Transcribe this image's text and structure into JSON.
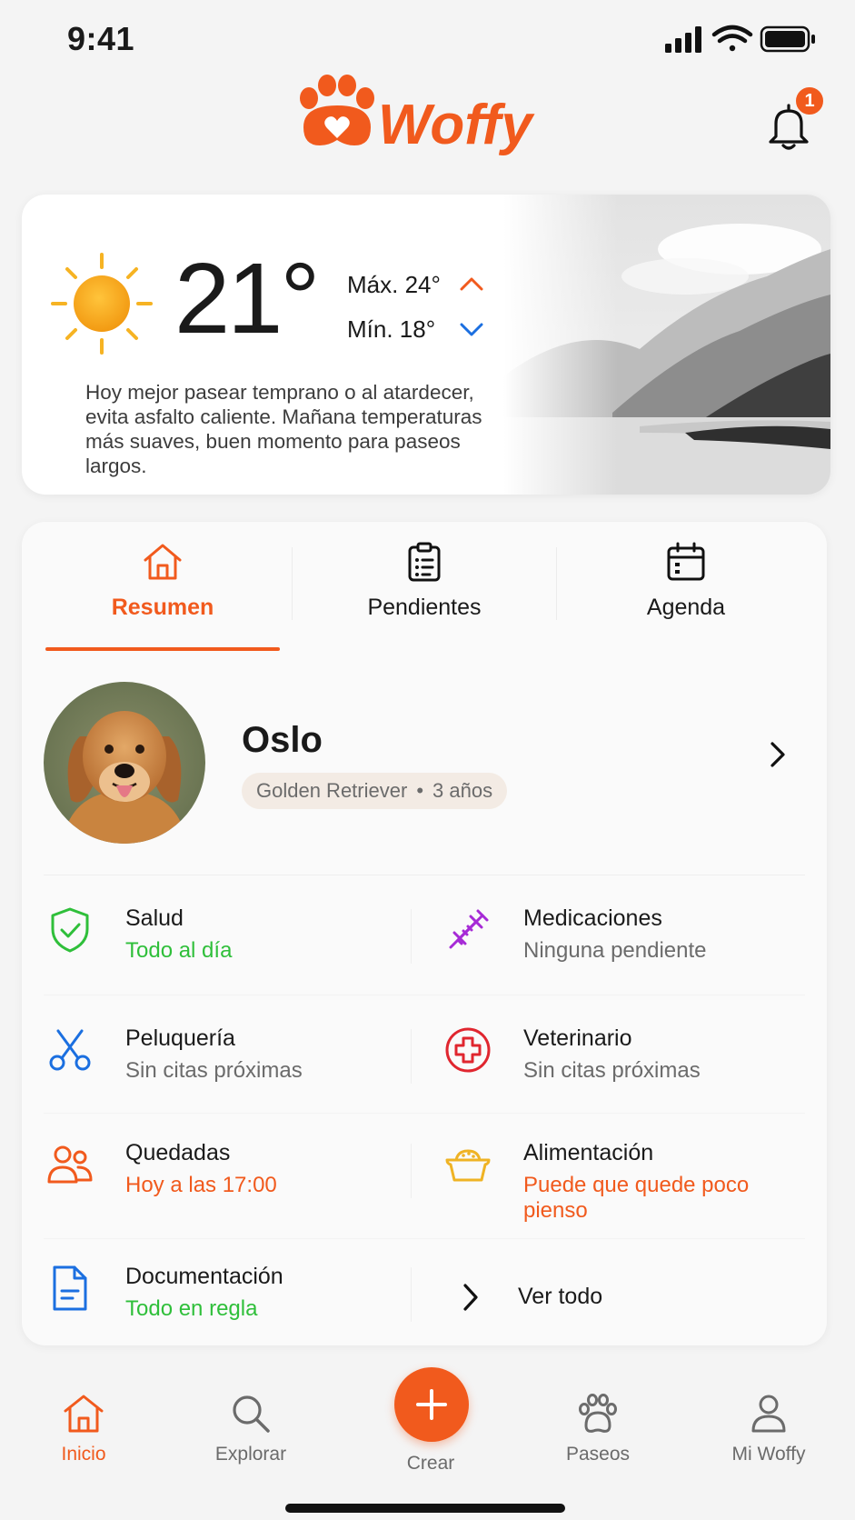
{
  "status_bar": {
    "time": "9:41"
  },
  "header": {
    "app_name": "Woffy",
    "notification_count": "1"
  },
  "weather": {
    "temperature": "21°",
    "max": "Máx. 24°",
    "min": "Mín. 18°",
    "message": "Hoy mejor pasear temprano o al atardecer, evita asfalto caliente. Mañana temperaturas más suaves, buen momento para paseos largos."
  },
  "tabs": [
    {
      "label": "Resumen",
      "icon": "home-icon",
      "active": true
    },
    {
      "label": "Pendientes",
      "icon": "clipboard-icon",
      "active": false
    },
    {
      "label": "Agenda",
      "icon": "calendar-icon",
      "active": false
    }
  ],
  "pet": {
    "name": "Oslo",
    "breed": "Golden Retriever",
    "age": "3 años"
  },
  "summary": {
    "salud": {
      "title": "Salud",
      "status": "Todo al día",
      "color": "#2fbf3a",
      "icon": "shield-check-icon"
    },
    "medicaciones": {
      "title": "Medicaciones",
      "status": "Ninguna pendiente",
      "color": "#6b6b6b",
      "icon": "syringe-icon"
    },
    "peluqueria": {
      "title": "Peluquería",
      "status": "Sin citas próximas",
      "color": "#6b6b6b",
      "icon": "scissors-icon"
    },
    "veterinario": {
      "title": "Veterinario",
      "status": "Sin citas próximas",
      "color": "#6b6b6b",
      "icon": "medical-cross-icon"
    },
    "quedadas": {
      "title": "Quedadas",
      "status": "Hoy a las 17:00",
      "color": "#f15a1d",
      "icon": "people-icon"
    },
    "alimentacion": {
      "title": "Alimentación",
      "status": "Puede que quede poco pienso",
      "color": "#f15a1d",
      "icon": "food-bowl-icon"
    },
    "documentacion": {
      "title": "Documentación",
      "status": "Todo en regla",
      "color": "#2fbf3a",
      "icon": "document-icon"
    },
    "ver_todo": "Ver todo"
  },
  "bottom_nav": [
    {
      "label": "Inicio",
      "icon": "home-icon",
      "active": true
    },
    {
      "label": "Explorar",
      "icon": "search-icon",
      "active": false
    },
    {
      "label": "Crear",
      "icon": "plus-icon",
      "active": false
    },
    {
      "label": "Paseos",
      "icon": "paw-icon",
      "active": false
    },
    {
      "label": "Mi Woffy",
      "icon": "user-icon",
      "active": false
    }
  ],
  "colors": {
    "accent": "#f15a1d",
    "success": "#2fbf3a",
    "purple": "#a62ad6",
    "blue": "#1b6fe0",
    "red": "#e0262f",
    "amber": "#efb324"
  }
}
